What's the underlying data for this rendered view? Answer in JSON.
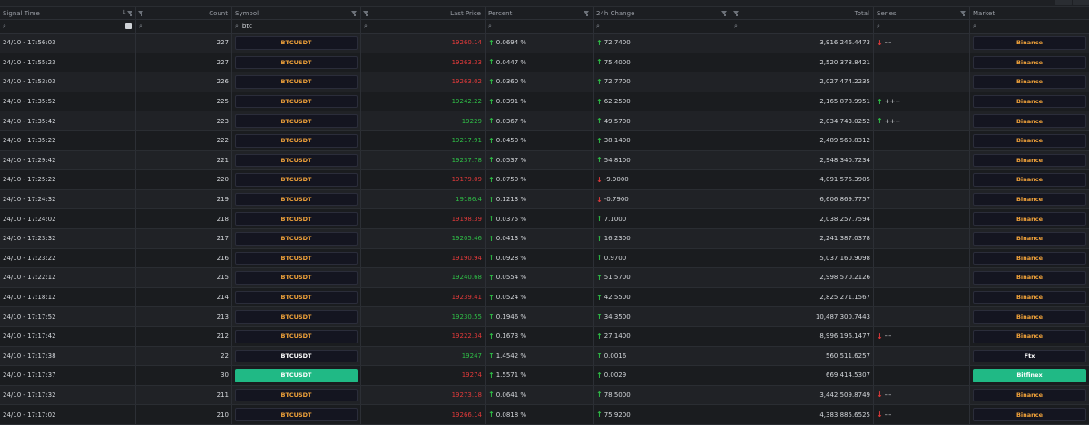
{
  "columns": {
    "signal_time": "Signal Time",
    "count": "Count",
    "symbol": "Symbol",
    "last_price": "Last Price",
    "percent": "Percent",
    "change_24h": "24h Change",
    "total": "Total",
    "series": "Series",
    "market": "Market"
  },
  "filters": {
    "symbol_value": "btc"
  },
  "colors": {
    "up": "#2fbf47",
    "down": "#e23a3a",
    "symbol_orange": "#f0a23a",
    "highlight_green": "#20b985"
  },
  "rows": [
    {
      "time": "24/10 - 17:56:03",
      "count": "227",
      "symbol": "BTCUSDT",
      "symbol_style": "orange",
      "price": "19260.14",
      "price_dir": "down",
      "percent": "0.0694 %",
      "pct_dir": "up",
      "change": "72.7400",
      "chg_dir": "up",
      "total": "3,916,246.4473",
      "series_dir": "down",
      "series": "---",
      "market": "Binance",
      "market_style": "orange"
    },
    {
      "time": "24/10 - 17:55:23",
      "count": "227",
      "symbol": "BTCUSDT",
      "symbol_style": "orange",
      "price": "19263.33",
      "price_dir": "down",
      "percent": "0.0447 %",
      "pct_dir": "up",
      "change": "75.4000",
      "chg_dir": "up",
      "total": "2,520,378.8421",
      "series_dir": "",
      "series": "",
      "market": "Binance",
      "market_style": "orange"
    },
    {
      "time": "24/10 - 17:53:03",
      "count": "226",
      "symbol": "BTCUSDT",
      "symbol_style": "orange",
      "price": "19263.02",
      "price_dir": "down",
      "percent": "0.0360 %",
      "pct_dir": "up",
      "change": "72.7700",
      "chg_dir": "up",
      "total": "2,027,474.2235",
      "series_dir": "",
      "series": "",
      "market": "Binance",
      "market_style": "orange"
    },
    {
      "time": "24/10 - 17:35:52",
      "count": "225",
      "symbol": "BTCUSDT",
      "symbol_style": "orange",
      "price": "19242.22",
      "price_dir": "up",
      "percent": "0.0391 %",
      "pct_dir": "up",
      "change": "62.2500",
      "chg_dir": "up",
      "total": "2,165,878.9951",
      "series_dir": "up",
      "series": "+++",
      "market": "Binance",
      "market_style": "orange"
    },
    {
      "time": "24/10 - 17:35:42",
      "count": "223",
      "symbol": "BTCUSDT",
      "symbol_style": "orange",
      "price": "19229",
      "price_dir": "up",
      "percent": "0.0367 %",
      "pct_dir": "up",
      "change": "49.5700",
      "chg_dir": "up",
      "total": "2,034,743.0252",
      "series_dir": "up",
      "series": "+++",
      "market": "Binance",
      "market_style": "orange"
    },
    {
      "time": "24/10 - 17:35:22",
      "count": "222",
      "symbol": "BTCUSDT",
      "symbol_style": "orange",
      "price": "19217.91",
      "price_dir": "up",
      "percent": "0.0450 %",
      "pct_dir": "up",
      "change": "38.1400",
      "chg_dir": "up",
      "total": "2,489,560.8312",
      "series_dir": "",
      "series": "",
      "market": "Binance",
      "market_style": "orange"
    },
    {
      "time": "24/10 - 17:29:42",
      "count": "221",
      "symbol": "BTCUSDT",
      "symbol_style": "orange",
      "price": "19237.78",
      "price_dir": "up",
      "percent": "0.0537 %",
      "pct_dir": "up",
      "change": "54.8100",
      "chg_dir": "up",
      "total": "2,948,340.7234",
      "series_dir": "",
      "series": "",
      "market": "Binance",
      "market_style": "orange"
    },
    {
      "time": "24/10 - 17:25:22",
      "count": "220",
      "symbol": "BTCUSDT",
      "symbol_style": "orange",
      "price": "19179.09",
      "price_dir": "down",
      "percent": "0.0750 %",
      "pct_dir": "up",
      "change": "-9.9000",
      "chg_dir": "down",
      "total": "4,091,576.3905",
      "series_dir": "",
      "series": "",
      "market": "Binance",
      "market_style": "orange"
    },
    {
      "time": "24/10 - 17:24:32",
      "count": "219",
      "symbol": "BTCUSDT",
      "symbol_style": "orange",
      "price": "19186.4",
      "price_dir": "up",
      "percent": "0.1213 %",
      "pct_dir": "up",
      "change": "-0.7900",
      "chg_dir": "down",
      "total": "6,606,869.7757",
      "series_dir": "",
      "series": "",
      "market": "Binance",
      "market_style": "orange"
    },
    {
      "time": "24/10 - 17:24:02",
      "count": "218",
      "symbol": "BTCUSDT",
      "symbol_style": "orange",
      "price": "19198.39",
      "price_dir": "down",
      "percent": "0.0375 %",
      "pct_dir": "up",
      "change": "7.1000",
      "chg_dir": "up",
      "total": "2,038,257.7594",
      "series_dir": "",
      "series": "",
      "market": "Binance",
      "market_style": "orange"
    },
    {
      "time": "24/10 - 17:23:32",
      "count": "217",
      "symbol": "BTCUSDT",
      "symbol_style": "orange",
      "price": "19205.46",
      "price_dir": "up",
      "percent": "0.0413 %",
      "pct_dir": "up",
      "change": "16.2300",
      "chg_dir": "up",
      "total": "2,241,387.0378",
      "series_dir": "",
      "series": "",
      "market": "Binance",
      "market_style": "orange"
    },
    {
      "time": "24/10 - 17:23:22",
      "count": "216",
      "symbol": "BTCUSDT",
      "symbol_style": "orange",
      "price": "19190.94",
      "price_dir": "down",
      "percent": "0.0928 %",
      "pct_dir": "up",
      "change": "0.9700",
      "chg_dir": "up",
      "total": "5,037,160.9098",
      "series_dir": "",
      "series": "",
      "market": "Binance",
      "market_style": "orange"
    },
    {
      "time": "24/10 - 17:22:12",
      "count": "215",
      "symbol": "BTCUSDT",
      "symbol_style": "orange",
      "price": "19240.68",
      "price_dir": "up",
      "percent": "0.0554 %",
      "pct_dir": "up",
      "change": "51.5700",
      "chg_dir": "up",
      "total": "2,998,570.2126",
      "series_dir": "",
      "series": "",
      "market": "Binance",
      "market_style": "orange"
    },
    {
      "time": "24/10 - 17:18:12",
      "count": "214",
      "symbol": "BTCUSDT",
      "symbol_style": "orange",
      "price": "19239.41",
      "price_dir": "down",
      "percent": "0.0524 %",
      "pct_dir": "up",
      "change": "42.5500",
      "chg_dir": "up",
      "total": "2,825,271.1567",
      "series_dir": "",
      "series": "",
      "market": "Binance",
      "market_style": "orange"
    },
    {
      "time": "24/10 - 17:17:52",
      "count": "213",
      "symbol": "BTCUSDT",
      "symbol_style": "orange",
      "price": "19230.55",
      "price_dir": "up",
      "percent": "0.1946 %",
      "pct_dir": "up",
      "change": "34.3500",
      "chg_dir": "up",
      "total": "10,487,300.7443",
      "series_dir": "",
      "series": "",
      "market": "Binance",
      "market_style": "orange"
    },
    {
      "time": "24/10 - 17:17:42",
      "count": "212",
      "symbol": "BTCUSDT",
      "symbol_style": "orange",
      "price": "19222.34",
      "price_dir": "down",
      "percent": "0.1673 %",
      "pct_dir": "up",
      "change": "27.1400",
      "chg_dir": "up",
      "total": "8,996,196.1477",
      "series_dir": "down",
      "series": "---",
      "market": "Binance",
      "market_style": "orange"
    },
    {
      "time": "24/10 - 17:17:38",
      "count": "22",
      "symbol": "BTCUSDT",
      "symbol_style": "white",
      "price": "19247",
      "price_dir": "up",
      "percent": "1.4542 %",
      "pct_dir": "up",
      "change": "0.0016",
      "chg_dir": "up",
      "total": "560,511.6257",
      "series_dir": "",
      "series": "",
      "market": "Ftx",
      "market_style": "white"
    },
    {
      "time": "24/10 - 17:17:37",
      "count": "30",
      "symbol": "BTCUSDT",
      "symbol_style": "green",
      "price": "19274",
      "price_dir": "down",
      "percent": "1.5571 %",
      "pct_dir": "up",
      "change": "0.0029",
      "chg_dir": "up",
      "total": "669,414.5307",
      "series_dir": "",
      "series": "",
      "market": "Bitfinex",
      "market_style": "green"
    },
    {
      "time": "24/10 - 17:17:32",
      "count": "211",
      "symbol": "BTCUSDT",
      "symbol_style": "orange",
      "price": "19273.18",
      "price_dir": "down",
      "percent": "0.0641 %",
      "pct_dir": "up",
      "change": "78.5000",
      "chg_dir": "up",
      "total": "3,442,509.8749",
      "series_dir": "down",
      "series": "---",
      "market": "Binance",
      "market_style": "orange"
    },
    {
      "time": "24/10 - 17:17:02",
      "count": "210",
      "symbol": "BTCUSDT",
      "symbol_style": "orange",
      "price": "19266.14",
      "price_dir": "down",
      "percent": "0.0818 %",
      "pct_dir": "up",
      "change": "75.9200",
      "chg_dir": "up",
      "total": "4,383,885.6525",
      "series_dir": "down",
      "series": "---",
      "market": "Binance",
      "market_style": "orange"
    }
  ]
}
